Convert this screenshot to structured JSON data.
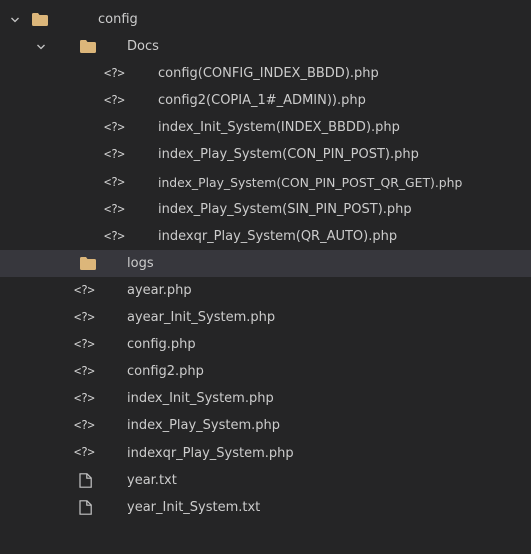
{
  "explorer": {
    "root": {
      "label": "config",
      "expanded": true,
      "children_folder": {
        "label": "Docs",
        "expanded": true,
        "files": [
          "config(CONFIG_INDEX_BBDD).php",
          "config2(COPIA_1#_ADMIN)).php",
          "index_Init_System(INDEX_BBDD).php",
          "index_Play_System(CON_PIN_POST).php",
          "index_Play_System(CON_PIN_POST_QR_GET).php",
          "index_Play_System(SIN_PIN_POST).php",
          "indexqr_Play_System(QR_AUTO).php"
        ]
      },
      "logs_folder": {
        "label": "logs",
        "selected": true
      },
      "php_files": [
        "ayear.php",
        "ayear_Init_System.php",
        "config.php",
        "config2.php",
        "index_Init_System.php",
        "index_Play_System.php",
        "indexqr_Play_System.php"
      ],
      "text_files": [
        "year.txt",
        "year_Init_System.txt"
      ]
    },
    "php_icon_glyph": "<?>",
    "colors": {
      "background": "#252526",
      "selected_row": "#37373d",
      "folder": "#dcb67a",
      "text": "#cccccc"
    }
  }
}
